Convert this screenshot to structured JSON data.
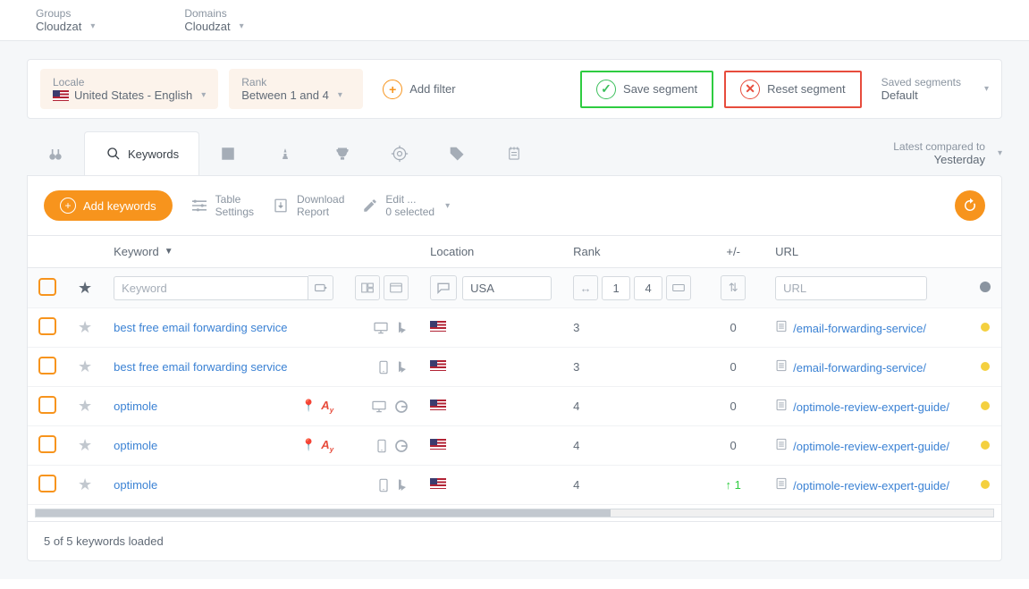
{
  "topbar": {
    "groups_label": "Groups",
    "groups_value": "Cloudzat",
    "domains_label": "Domains",
    "domains_value": "Cloudzat"
  },
  "filters": {
    "locale_label": "Locale",
    "locale_value": "United States - English",
    "rank_label": "Rank",
    "rank_value": "Between 1 and 4",
    "add_filter": "Add filter",
    "save_segment": "Save segment",
    "reset_segment": "Reset segment",
    "saved_label": "Saved segments",
    "saved_value": "Default"
  },
  "tabs": {
    "keywords": "Keywords"
  },
  "comparison": {
    "label": "Latest compared to",
    "value": "Yesterday"
  },
  "toolbar": {
    "add_keywords": "Add keywords",
    "table_top": "Table",
    "table_sub": "Settings",
    "download_top": "Download",
    "download_sub": "Report",
    "edit_top": "Edit ...",
    "edit_sub": "0 selected"
  },
  "headers": {
    "keyword": "Keyword",
    "location": "Location",
    "rank": "Rank",
    "change": "+/-",
    "url": "URL"
  },
  "filterInputs": {
    "keyword_ph": "Keyword",
    "location_val": "USA",
    "rank_from": "1",
    "rank_to": "4",
    "url_ph": "URL"
  },
  "rows": [
    {
      "keyword": "best free email forwarding service",
      "device": "desktop",
      "engine": "bing",
      "badges": false,
      "rank": "3",
      "change": "0",
      "up": false,
      "url": "/email-forwarding-service/"
    },
    {
      "keyword": "best free email forwarding service",
      "device": "mobile",
      "engine": "bing",
      "badges": false,
      "rank": "3",
      "change": "0",
      "up": false,
      "url": "/email-forwarding-service/"
    },
    {
      "keyword": "optimole",
      "device": "desktop",
      "engine": "google",
      "badges": true,
      "rank": "4",
      "change": "0",
      "up": false,
      "url": "/optimole-review-expert-guide/"
    },
    {
      "keyword": "optimole",
      "device": "mobile",
      "engine": "google",
      "badges": true,
      "rank": "4",
      "change": "0",
      "up": false,
      "url": "/optimole-review-expert-guide/"
    },
    {
      "keyword": "optimole",
      "device": "mobile",
      "engine": "bing",
      "badges": false,
      "rank": "4",
      "change": "1",
      "up": true,
      "url": "/optimole-review-expert-guide/"
    }
  ],
  "footer": "5 of 5 keywords loaded"
}
